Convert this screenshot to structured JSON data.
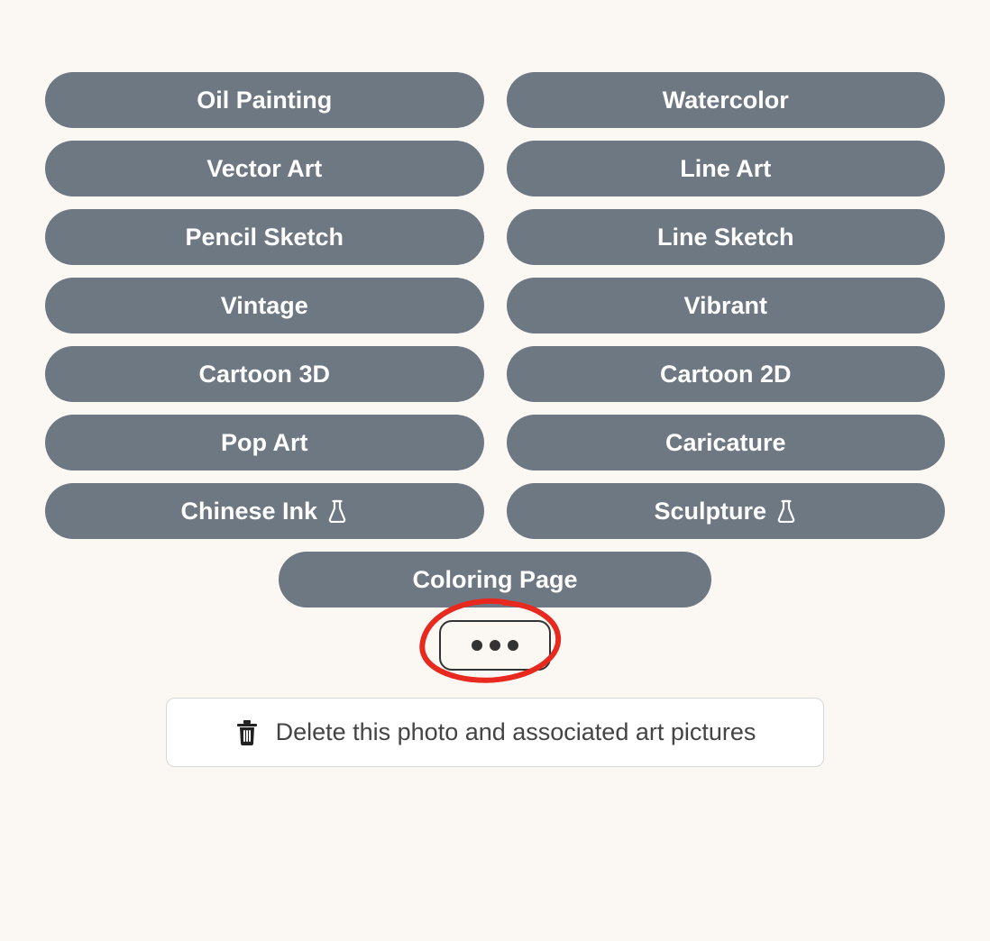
{
  "styles": [
    {
      "label": "Oil Painting",
      "experimental": false
    },
    {
      "label": "Watercolor",
      "experimental": false
    },
    {
      "label": "Vector Art",
      "experimental": false
    },
    {
      "label": "Line Art",
      "experimental": false
    },
    {
      "label": "Pencil Sketch",
      "experimental": false
    },
    {
      "label": "Line Sketch",
      "experimental": false
    },
    {
      "label": "Vintage",
      "experimental": false
    },
    {
      "label": "Vibrant",
      "experimental": false
    },
    {
      "label": "Cartoon 3D",
      "experimental": false
    },
    {
      "label": "Cartoon 2D",
      "experimental": false
    },
    {
      "label": "Pop Art",
      "experimental": false
    },
    {
      "label": "Caricature",
      "experimental": false
    },
    {
      "label": "Chinese Ink",
      "experimental": true
    },
    {
      "label": "Sculpture",
      "experimental": true
    },
    {
      "label": "Coloring Page",
      "experimental": false
    }
  ],
  "delete": {
    "label": "Delete this photo and associated art pictures"
  },
  "colors": {
    "pill_bg": "#6e7882",
    "pill_text": "#ffffff",
    "page_bg": "#fbf8f3",
    "annotation": "#e8291f"
  }
}
